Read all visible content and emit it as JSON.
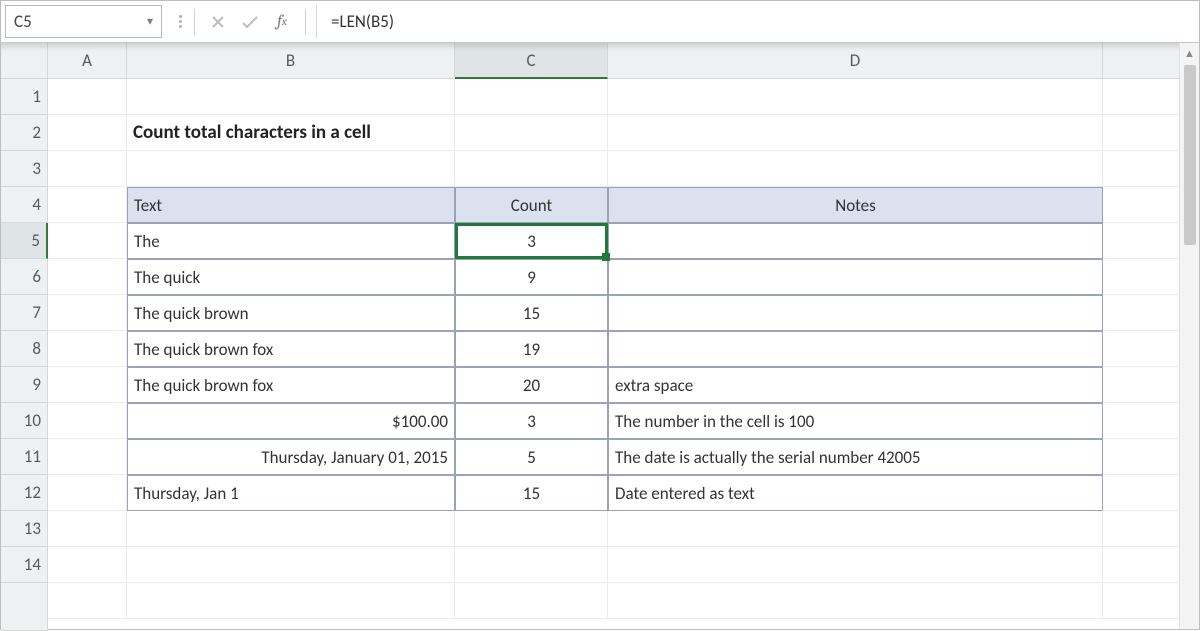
{
  "name_box": "C5",
  "formula": "=LEN(B5)",
  "columns": [
    "A",
    "B",
    "C",
    "D"
  ],
  "row_labels": [
    "1",
    "2",
    "3",
    "4",
    "5",
    "6",
    "7",
    "8",
    "9",
    "10",
    "11",
    "12",
    "13",
    "14"
  ],
  "title": "Count total characters in a cell",
  "table": {
    "headers": {
      "text": "Text",
      "count": "Count",
      "notes": "Notes"
    },
    "rows": [
      {
        "text": "The",
        "count": "3",
        "notes": ""
      },
      {
        "text": "The quick",
        "count": "9",
        "notes": ""
      },
      {
        "text": "The quick brown",
        "count": "15",
        "notes": ""
      },
      {
        "text": "The quick brown fox",
        "count": "19",
        "notes": ""
      },
      {
        "text": "The quick brown  fox",
        "count": "20",
        "notes": "extra space"
      },
      {
        "text": "$100.00",
        "count": "3",
        "notes": "The number in the cell is 100",
        "align": "right"
      },
      {
        "text": "Thursday, January 01, 2015",
        "count": "5",
        "notes": "The date is actually the serial number 42005",
        "align": "right"
      },
      {
        "text": "Thursday, Jan 1",
        "count": "15",
        "notes": "Date entered as text"
      }
    ]
  },
  "active_cell": "C5",
  "colors": {
    "header_bg": "#dbe1ef",
    "table_border": "#9aa3b5",
    "selection": "#1f7a3a"
  }
}
